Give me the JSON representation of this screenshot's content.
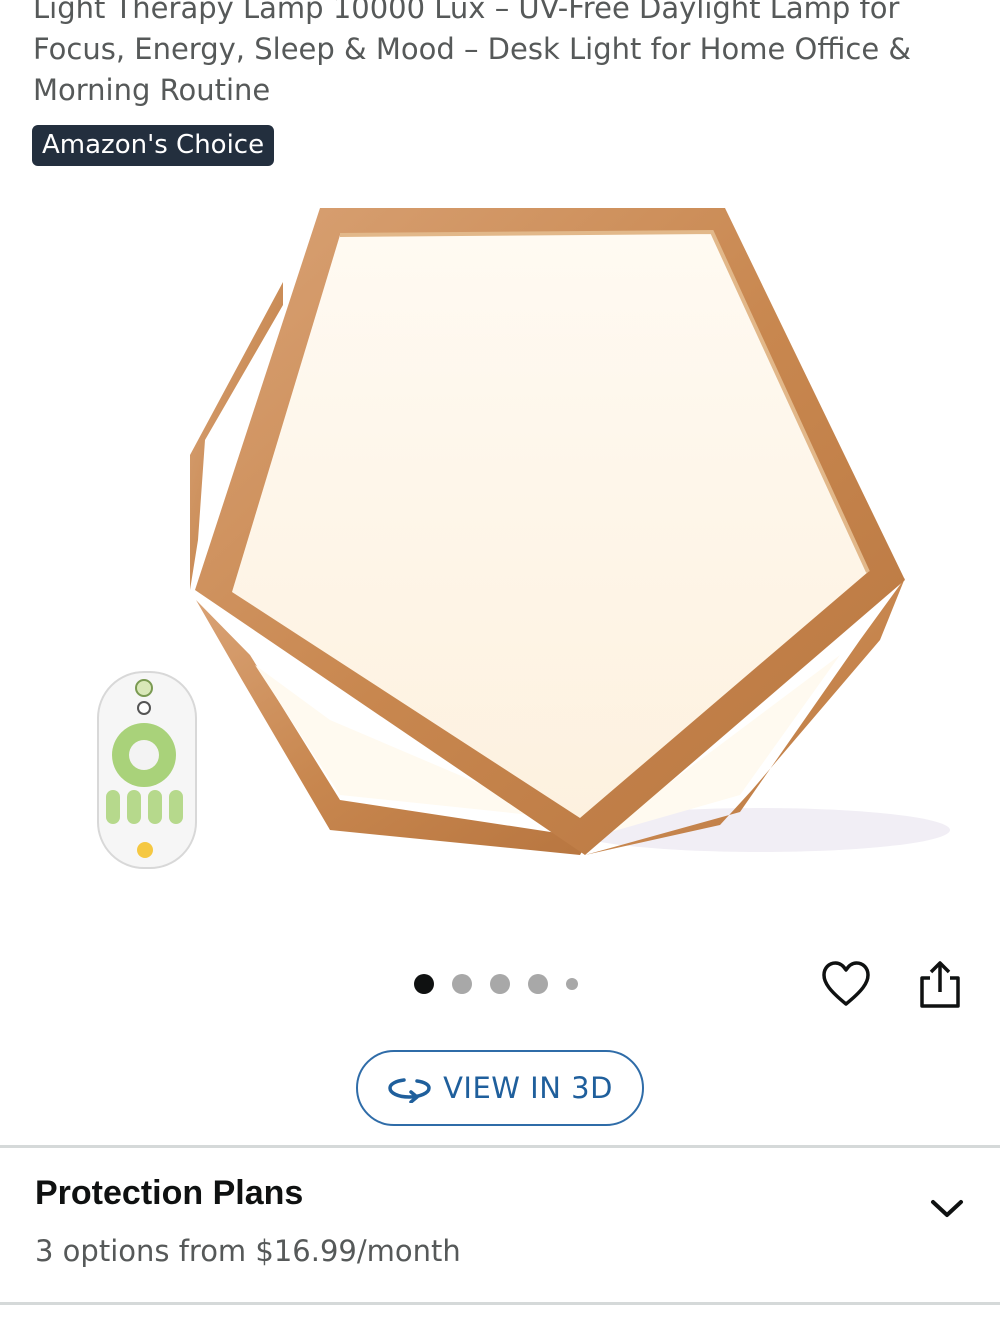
{
  "product": {
    "title": "Light Therapy Lamp 10000 Lux – UV-Free Daylight Lamp for Focus, Energy, Sleep & Mood – Desk Light for Home Office & Morning Routine",
    "badge": "Amazon's Choice"
  },
  "gallery": {
    "image_count": 5,
    "active_index": 0
  },
  "actions": {
    "wishlist_icon": "heart-icon",
    "share_icon": "share-icon",
    "view_3d_label": "VIEW IN 3D"
  },
  "protection_plans": {
    "heading": "Protection Plans",
    "subtext": "3 options from $16.99/month"
  },
  "colors": {
    "badge_bg": "#232f3e",
    "link_blue": "#1f5f9c",
    "wood": "#c98a56"
  }
}
